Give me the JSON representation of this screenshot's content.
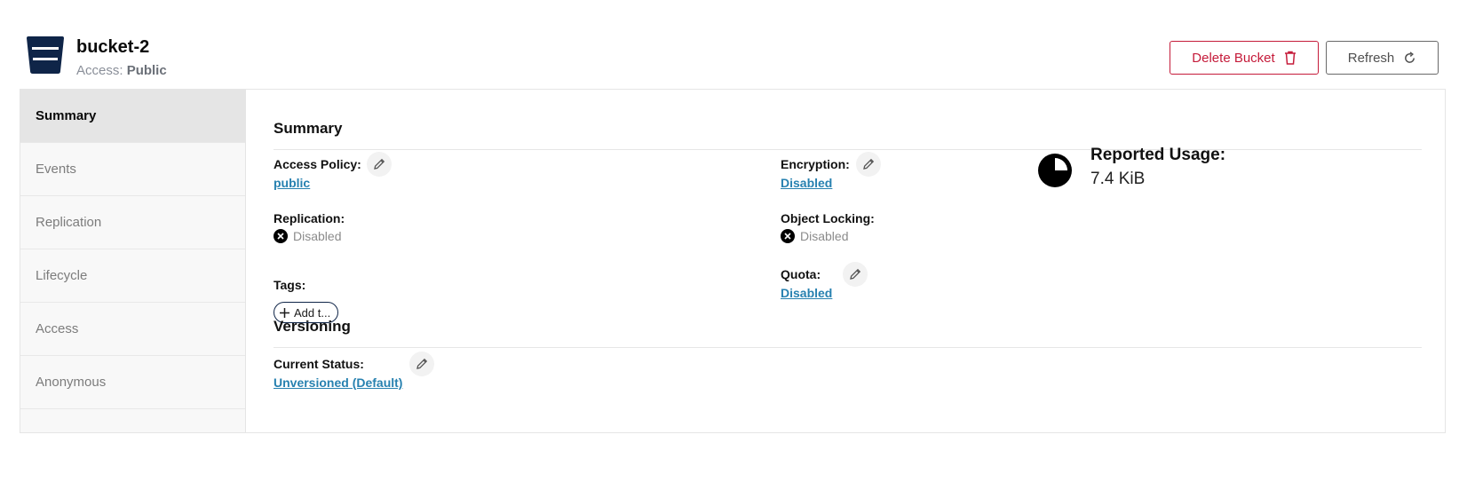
{
  "header": {
    "bucket_name": "bucket-2",
    "access_prefix": "Access:",
    "access_value": "Public",
    "delete_label": "Delete Bucket",
    "refresh_label": "Refresh"
  },
  "sidebar": {
    "items": [
      {
        "label": "Summary",
        "active": true
      },
      {
        "label": "Events",
        "active": false
      },
      {
        "label": "Replication",
        "active": false
      },
      {
        "label": "Lifecycle",
        "active": false
      },
      {
        "label": "Access",
        "active": false
      },
      {
        "label": "Anonymous",
        "active": false
      }
    ]
  },
  "summary": {
    "title": "Summary",
    "access_policy_label": "Access Policy:",
    "access_policy_value": "public",
    "replication_label": "Replication:",
    "replication_value": "Disabled",
    "tags_label": "Tags:",
    "add_tag_label": "Add t...",
    "encryption_label": "Encryption:",
    "encryption_value": "Disabled",
    "object_locking_label": "Object Locking:",
    "object_locking_value": "Disabled",
    "quota_label": "Quota:",
    "quota_value": "Disabled",
    "usage_label": "Reported Usage:",
    "usage_value": "7.4 KiB"
  },
  "versioning": {
    "title": "Versioning",
    "current_status_label": "Current Status:",
    "current_status_value": "Unversioned (Default)"
  },
  "colors": {
    "brand_navy": "#0f2548",
    "danger": "#c51b3a",
    "link": "#2781b0"
  },
  "icons": {
    "bucket": "bucket-icon",
    "delete": "trash-icon",
    "refresh": "refresh-icon",
    "edit": "pencil-icon",
    "disabled": "x-circle-icon",
    "add": "plus-icon",
    "usage": "pie-chart-icon"
  }
}
